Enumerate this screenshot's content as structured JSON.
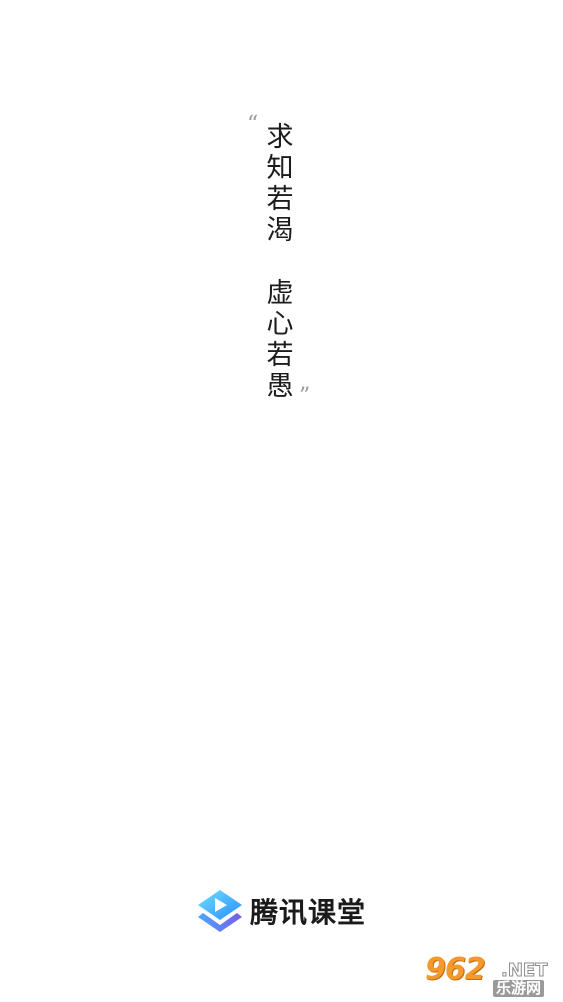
{
  "quote": {
    "open_mark": "“",
    "close_mark": "”",
    "line1": [
      "求",
      "知",
      "若",
      "渴"
    ],
    "line2": [
      "虚",
      "心",
      "若",
      "愚"
    ]
  },
  "brand": {
    "name": "腾讯课堂",
    "logo_icon": "tencent-classroom-logo-icon",
    "colors": {
      "logo_light": "#5fd0ff",
      "logo_mid": "#2ea7ff",
      "logo_dark": "#6a59e6"
    }
  },
  "watermark": {
    "number": "962",
    "domain": ".NET",
    "site_name": "乐游网",
    "color": "#f39a2b"
  }
}
